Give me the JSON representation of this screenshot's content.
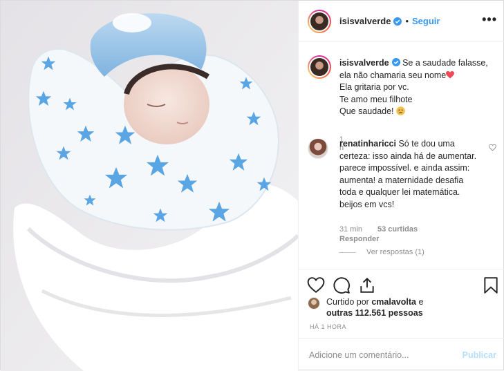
{
  "post": {
    "author": "isisvalverde",
    "follow_label": "Seguir",
    "separator": "•",
    "more_label": "•••",
    "caption_lines": [
      "Se a saudade falasse,",
      "ela não chamaria seu nome",
      "Ela gritaria por vc.",
      "Te amo meu filhote",
      "Que saudade! "
    ],
    "caption_time": "1 h"
  },
  "comment": {
    "author": "renatinharicci",
    "text": "Só te dou uma certeza: isso ainda há de aumentar. parece impossível. e ainda assim: aumenta! a maternidade desafia toda e qualquer lei matemática. beijos em vcs!",
    "time": "31 min",
    "likes": "53 curtidas",
    "reply_label": "Responder",
    "view_replies": "Ver respostas (1)"
  },
  "likes_summary": {
    "prefix": "Curtido por",
    "user": "cmalavolta",
    "connector": "e",
    "others": "outras 112.561 pessoas"
  },
  "post_time": "HÁ 1 HORA",
  "add_comment": {
    "placeholder": "Adicione um comentário...",
    "publish_label": "Publicar"
  },
  "colors": {
    "link_blue": "#3897f0",
    "verified_blue": "#3897f0",
    "heart_red": "#ed4956",
    "disabled_blue": "#b2dffc",
    "muted_text": "#8e8e8e",
    "star_blue": "#5aa5e3"
  },
  "icons": [
    "verified-badge-icon",
    "heart-icon",
    "comment-icon",
    "share-icon",
    "bookmark-icon",
    "more-options-icon",
    "red-heart-emoji-icon",
    "sad-face-emoji-icon"
  ]
}
